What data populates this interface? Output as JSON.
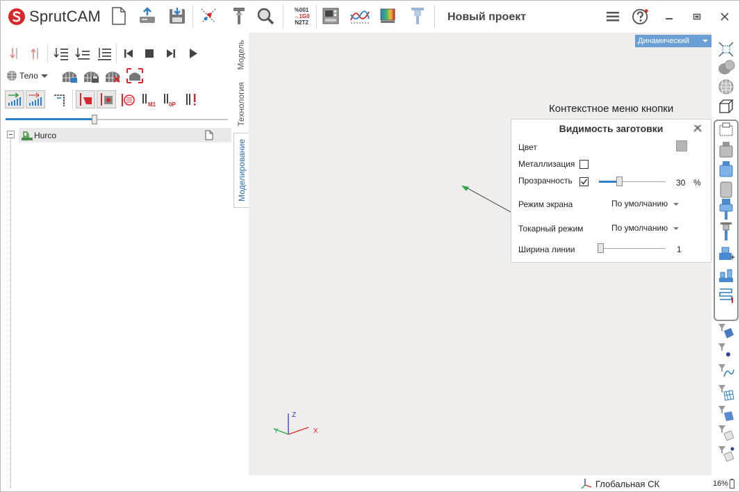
{
  "app": {
    "name": "SprutCAM",
    "project_title": "Новый проект"
  },
  "toolbar": {
    "nc_code_lines": [
      "%001",
      "→1G0",
      "N2T2"
    ]
  },
  "left_panel": {
    "body_selector": "Тело",
    "tree_root": "Hurco"
  },
  "tabs": [
    {
      "label": "Модель",
      "active": false
    },
    {
      "label": "Технология",
      "active": false
    },
    {
      "label": "Моделирование",
      "active": true
    }
  ],
  "viewport": {
    "view_mode": "Динамический",
    "context_caption": "Контекстное меню кнопки",
    "axis_labels": {
      "x": "X",
      "y": "Y",
      "z": "Z"
    }
  },
  "visibility_panel": {
    "title": "Видимость заготовки",
    "color_label": "Цвет",
    "metallization_label": "Металлизация",
    "metallization_checked": false,
    "transparency_label": "Прозрачность",
    "transparency_checked": true,
    "transparency_value": "30",
    "transparency_unit": "%",
    "screen_mode_label": "Режим экрана",
    "screen_mode_value": "По умолчанию",
    "turning_mode_label": "Токарный режим",
    "turning_mode_value": "По умолчанию",
    "line_width_label": "Ширина линии",
    "line_width_value": "1",
    "swatch_color": "#b4b4b4"
  },
  "status_bar": {
    "coordinate_system": "Глобальная СК",
    "zoom": "16%"
  },
  "colors": {
    "accent": "#2c7fc4",
    "view_mode_bg": "#6a9fd6",
    "logo_red": "#d9262a",
    "viewport_bg": "#efeeed"
  }
}
